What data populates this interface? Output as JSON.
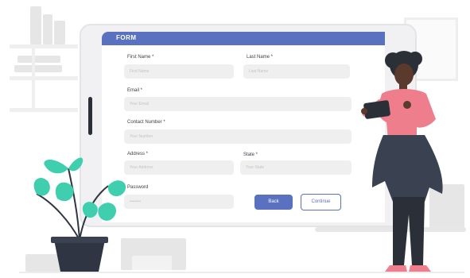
{
  "form": {
    "title": "FORM",
    "first_name_label": "First Name *",
    "first_name_placeholder": "First Name",
    "last_name_label": "Last Name *",
    "last_name_placeholder": "Last Name",
    "email_label": "Email *",
    "email_placeholder": "Your Email",
    "contact_label": "Contact Number *",
    "contact_placeholder": "Your Number",
    "address_label": "Address *",
    "address_placeholder": "Your Address",
    "state_label": "State *",
    "state_placeholder": "Your State",
    "password_label": "Password",
    "password_placeholder": "••••••••",
    "back_button": "Back",
    "continue_button": "Continue"
  },
  "colors": {
    "accent": "#5a71c0",
    "shirt": "#ef7e8c",
    "plant": "#3fcfae",
    "jacket": "#3a4251"
  }
}
